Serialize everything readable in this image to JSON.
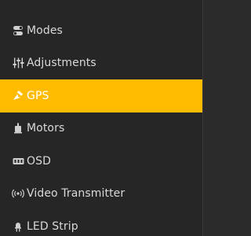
{
  "menu": {
    "items": [
      {
        "label": "Modes",
        "icon": "toggle-switch-icon",
        "active": false
      },
      {
        "label": "Adjustments",
        "icon": "sliders-icon",
        "active": false
      },
      {
        "label": "GPS",
        "icon": "satellite-icon",
        "active": true
      },
      {
        "label": "Motors",
        "icon": "motor-icon",
        "active": false
      },
      {
        "label": "OSD",
        "icon": "osd-icon",
        "active": false
      },
      {
        "label": "Video Transmitter",
        "icon": "broadcast-icon",
        "active": false
      },
      {
        "label": "LED Strip",
        "icon": "led-icon",
        "active": false
      }
    ]
  },
  "colors": {
    "background": "#262626",
    "text": "#d9d9d9",
    "active_background": "#ffbb00",
    "active_text": "#ffffff"
  }
}
